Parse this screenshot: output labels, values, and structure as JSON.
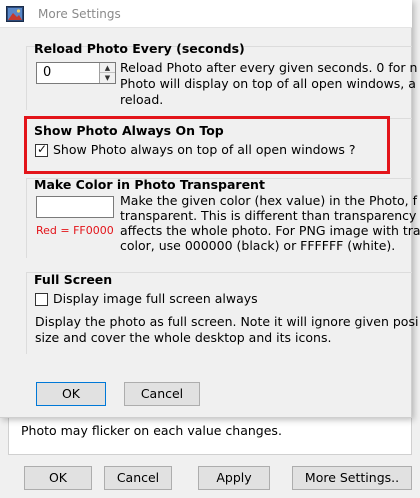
{
  "window": {
    "title": "More Settings"
  },
  "reload": {
    "title": "Reload Photo Every (seconds)",
    "value": "0",
    "desc_lines": [
      "Reload Photo after every given seconds. 0 for n",
      "Photo will display on top of all open windows, a",
      "reload."
    ]
  },
  "ontop": {
    "title": "Show Photo Always On Top",
    "checkbox_label": "Show Photo always on top of all open windows ?",
    "checked": true,
    "highlight_color": "#e3141a"
  },
  "transparent": {
    "title": "Make Color in Photo Transparent",
    "value": "",
    "hint": "Red = FF0000",
    "desc_lines": [
      "Make the given color (hex value) in the Photo, f",
      "transparent. This is different than transparency",
      "affects the whole photo. For PNG image with tra",
      "color, use 000000 (black) or FFFFFF (white)."
    ]
  },
  "fullscreen": {
    "title": "Full Screen",
    "checkbox_label": "Display image full screen always",
    "checked": false,
    "desc_lines": [
      "Display the photo as full screen. Note it will ignore given posi",
      "size and cover the whole desktop and its icons."
    ]
  },
  "buttons": {
    "ok": "OK",
    "cancel": "Cancel"
  },
  "parent": {
    "note": "Photo may flicker on each value changes.",
    "buttons": {
      "ok": "OK",
      "cancel": "Cancel",
      "apply": "Apply",
      "more": "More Settings.."
    }
  },
  "icons": {
    "app_icon": "photo-icon",
    "spin_up": "chevron-up-icon",
    "spin_down": "chevron-down-icon",
    "check": "check-icon"
  },
  "colors": {
    "accent": "#0078d7",
    "red": "#e3141a"
  }
}
